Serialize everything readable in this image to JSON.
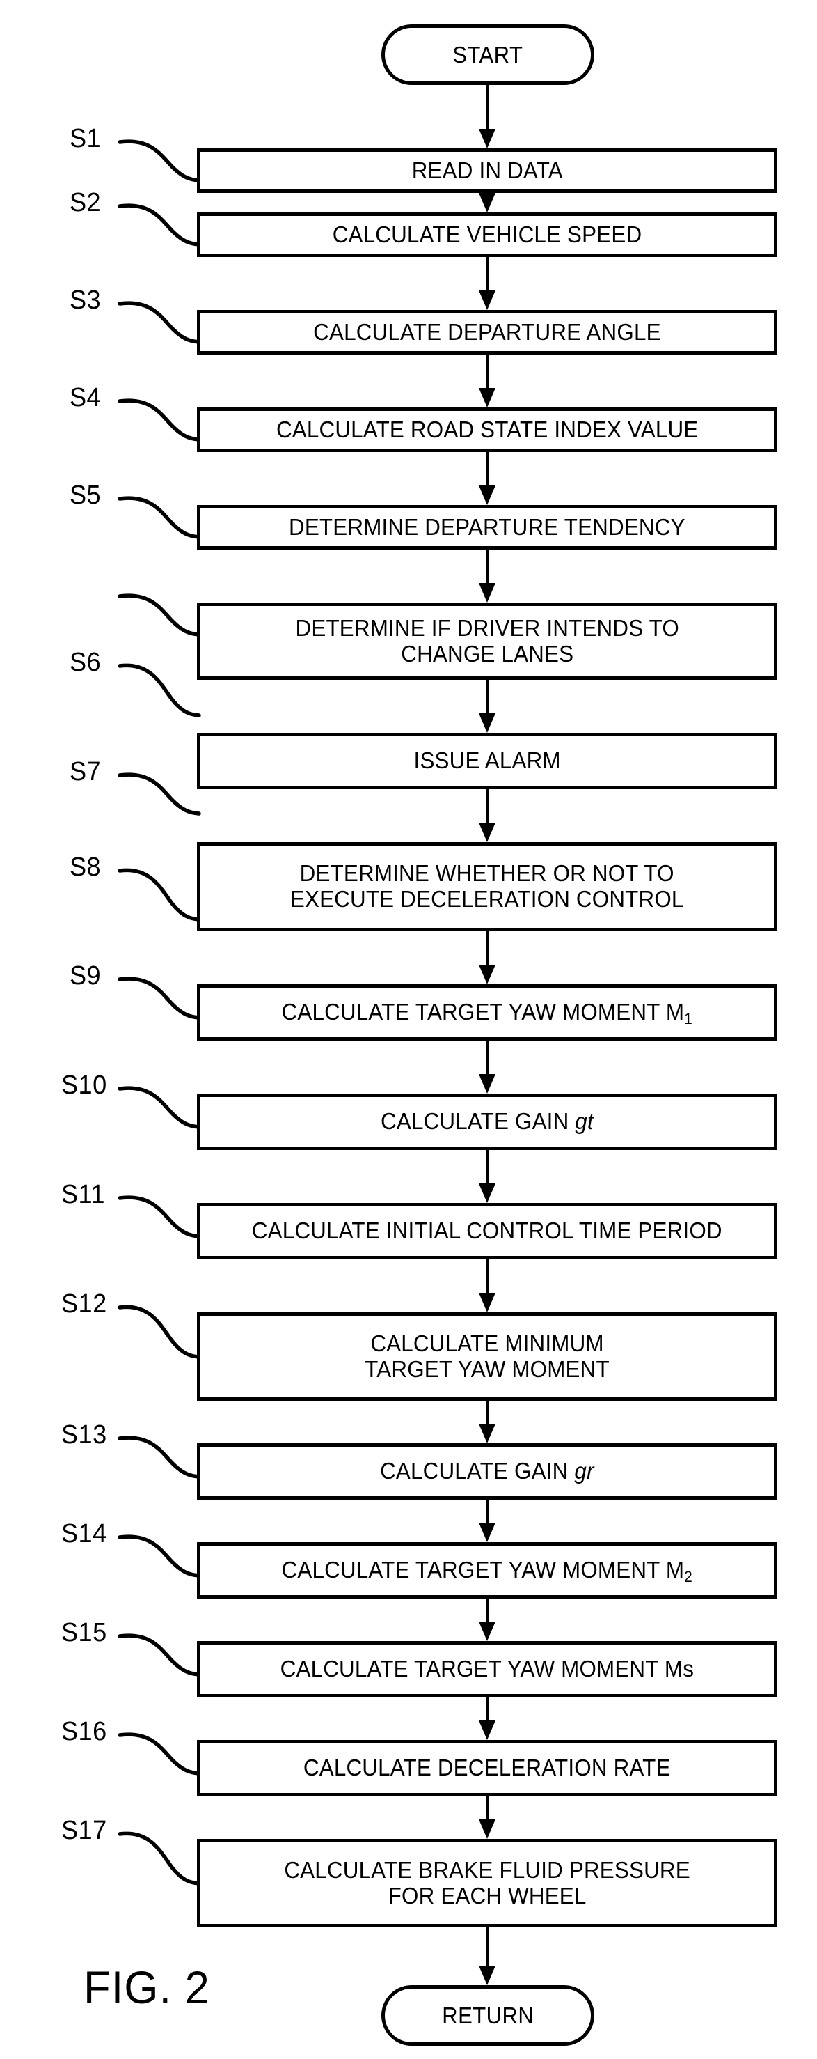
{
  "figure": {
    "caption": "FIG. 2",
    "type": "process-flowchart"
  },
  "terminals": {
    "start": "START",
    "end": "RETURN"
  },
  "steps": [
    {
      "id": "S1",
      "label": "S1",
      "text": "READ IN DATA"
    },
    {
      "id": "S2",
      "label": "S2",
      "text": "CALCULATE VEHICLE SPEED"
    },
    {
      "id": "S3",
      "label": "S3",
      "text": "CALCULATE DEPARTURE ANGLE"
    },
    {
      "id": "S4",
      "label": "S4",
      "text": "CALCULATE ROAD STATE INDEX VALUE"
    },
    {
      "id": "S5",
      "label": "S5",
      "text": "DETERMINE DEPARTURE TENDENCY"
    },
    {
      "id": "S6",
      "label": "S6",
      "text": "DETERMINE IF DRIVER INTENDS TO\nCHANGE LANES"
    },
    {
      "id": "S7",
      "label": "S7",
      "text": "ISSUE ALARM"
    },
    {
      "id": "S8",
      "label": "S8",
      "text": "DETERMINE WHETHER OR NOT TO\nEXECUTE DECELERATION CONTROL"
    },
    {
      "id": "S9",
      "label": "S9",
      "text": "CALCULATE TARGET YAW MOMENT M1"
    },
    {
      "id": "S10",
      "label": "S10",
      "text": "CALCULATE GAIN gt"
    },
    {
      "id": "S11",
      "label": "S11",
      "text": "CALCULATE INITIAL CONTROL TIME PERIOD"
    },
    {
      "id": "S12",
      "label": "S12",
      "text": "CALCULATE MINIMUM\nTARGET YAW MOMENT"
    },
    {
      "id": "S13",
      "label": "S13",
      "text": "CALCULATE GAIN gr"
    },
    {
      "id": "S14",
      "label": "S14",
      "text": "CALCULATE TARGET YAW MOMENT M2"
    },
    {
      "id": "S15",
      "label": "S15",
      "text": "CALCULATE TARGET YAW MOMENT Ms"
    },
    {
      "id": "S16",
      "label": "S16",
      "text": "CALCULATE DECELERATION RATE"
    },
    {
      "id": "S17",
      "label": "S17",
      "text": "CALCULATE BRAKE FLUID PRESSURE\nFOR EACH WHEEL"
    }
  ],
  "colors": {
    "stroke": "#000000",
    "background": "#ffffff"
  }
}
